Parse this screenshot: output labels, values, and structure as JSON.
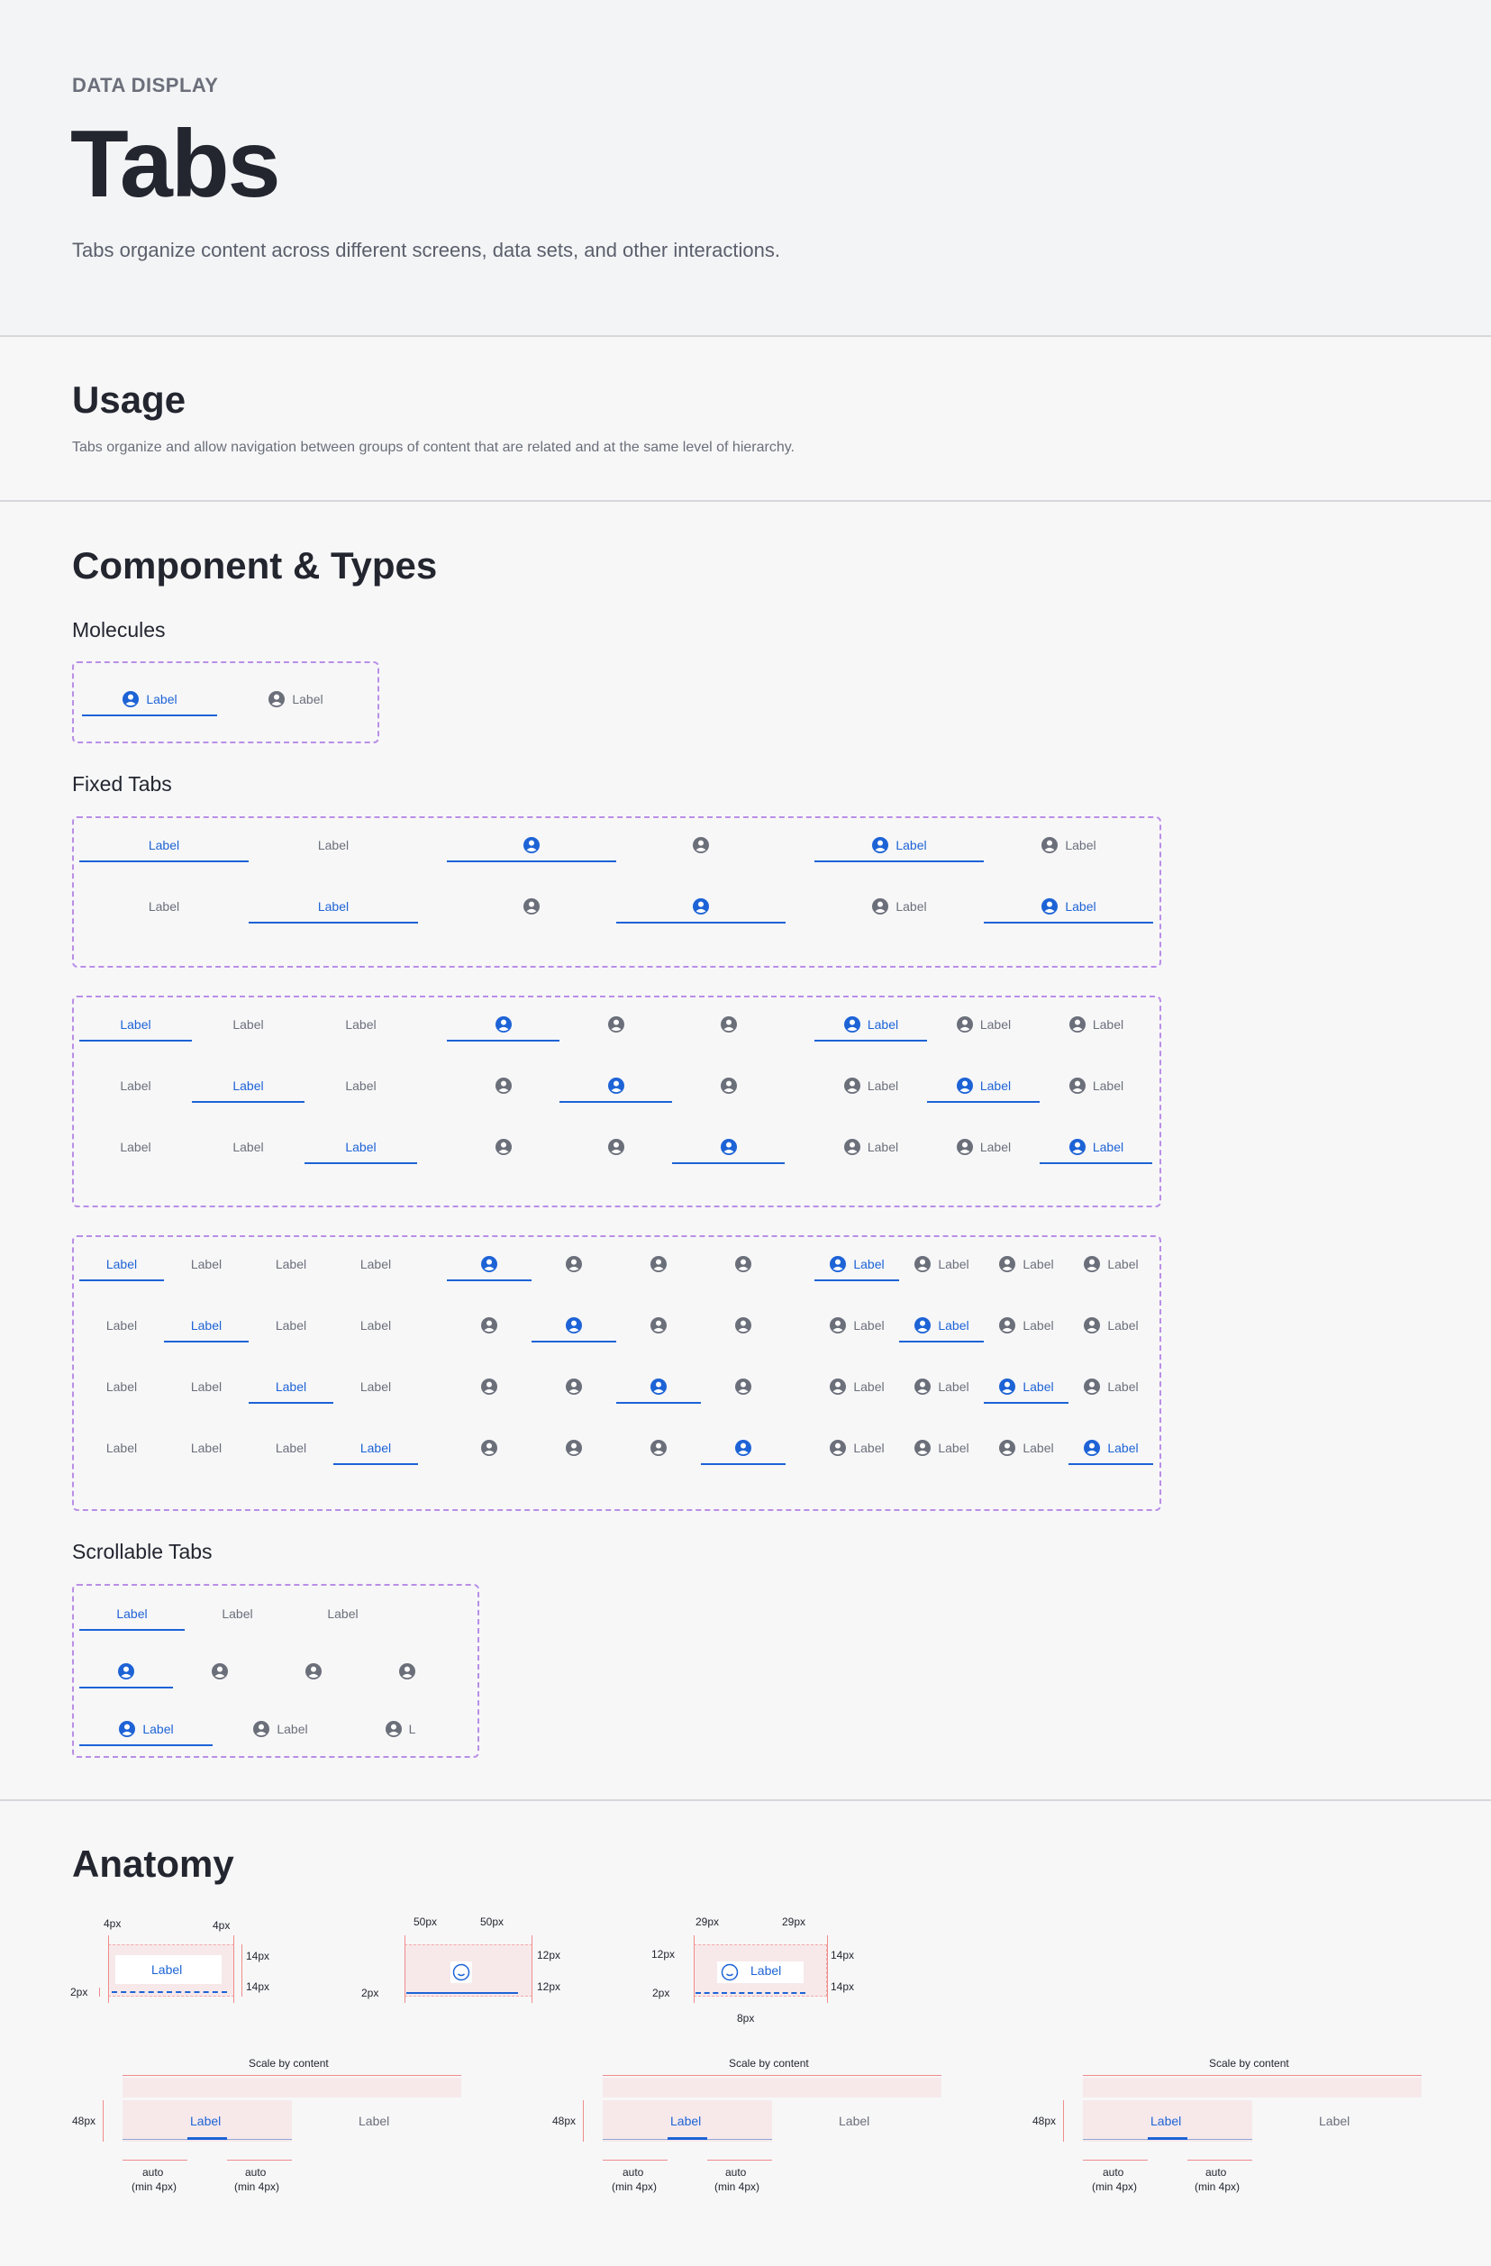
{
  "header": {
    "eyebrow": "DATA DISPLAY",
    "title": "Tabs",
    "description": "Tabs organize content across different screens, data sets, and other interactions."
  },
  "usage": {
    "title": "Usage",
    "description": "Tabs organize and allow navigation between groups of content that are related and at the same level of hierarchy."
  },
  "components": {
    "title": "Component & Types",
    "molecules_title": "Molecules",
    "fixed_title": "Fixed Tabs",
    "scroll_title": "Scrollable Tabs",
    "tab_label": "Label",
    "truncated_label": "L"
  },
  "anatomy": {
    "title": "Anatomy",
    "tab_label": "Label",
    "m4": "4px",
    "m14": "14px",
    "m2": "2px",
    "m50": "50px",
    "m12": "12px",
    "m29": "29px",
    "m8": "8px",
    "scale_label": "Scale by content",
    "height_label": "48px",
    "auto_label": "auto",
    "min_label": "(min 4px)"
  },
  "colors": {
    "active": "#1d63d6",
    "inactive": "#6b6f7a",
    "outline": "#b98ee6",
    "spec": "#e25b5b"
  }
}
